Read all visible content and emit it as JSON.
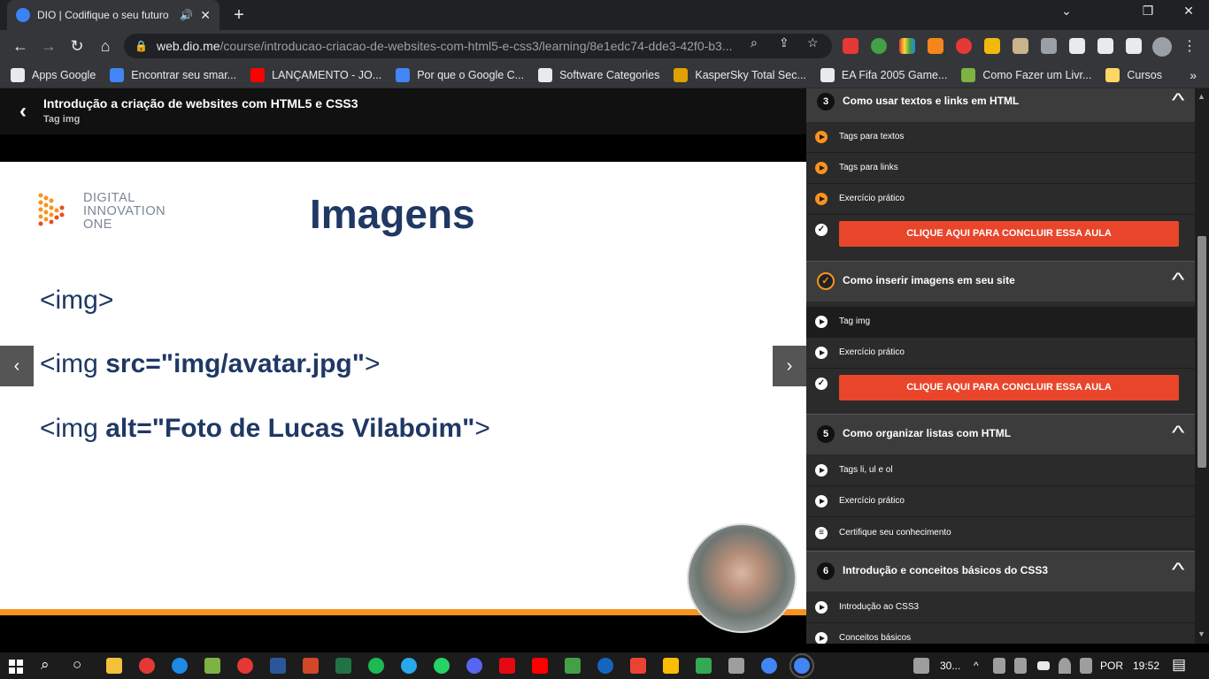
{
  "browser": {
    "tab_title": "DIO | Codifique o seu futuro",
    "tab_audio_icon": "🔊",
    "tab_close_icon": "✕",
    "new_tab_icon": "+",
    "url_host": "web.dio.me",
    "url_path": "/course/introducao-criacao-de-websites-com-html5-e-css3/learning/8e1edc74-dde3-42f0-b3...",
    "window_controls": [
      "⌄",
      "❐",
      "✕"
    ],
    "bookmarks": [
      {
        "label": "Apps Google",
        "color": "#e8eaed"
      },
      {
        "label": "Encontrar seu smar...",
        "color": "#4285f4"
      },
      {
        "label": "LANÇAMENTO - JO...",
        "color": "#ff0000"
      },
      {
        "label": "Por que o Google C...",
        "color": "#4285f4"
      },
      {
        "label": "Software Categories",
        "color": "#e8eaed"
      },
      {
        "label": "KasperSky Total Sec...",
        "color": "#e0a000"
      },
      {
        "label": "EA Fifa 2005 Game...",
        "color": "#e8eaed"
      },
      {
        "label": "Como Fazer um Livr...",
        "color": "#7cb342"
      },
      {
        "label": "Cursos",
        "color": "#fdd663"
      }
    ],
    "bookmarks_more": "»"
  },
  "course": {
    "title": "Introdução a criação de websites com HTML5 e CSS3",
    "current_lesson": "Tag img",
    "back_icon": "‹"
  },
  "slide": {
    "logo_text": [
      "DIGITAL",
      "INNOVATION",
      "ONE"
    ],
    "title": "Imagens",
    "line1": "<img>",
    "line2_prefix": "<img ",
    "line2_bold": "src=\"img/avatar.jpg\"",
    "line2_suffix": ">",
    "line3_prefix": "<img ",
    "line3_bold": "alt=\"Foto de Lucas Vilaboim\"",
    "line3_suffix": ">",
    "prev_icon": "‹",
    "next_icon": "›"
  },
  "sidebar": {
    "sections": [
      {
        "number": "3",
        "title": "Como usar textos e links em HTML",
        "items": [
          "Tags para textos",
          "Tags para links",
          "Exercício prático"
        ],
        "cta": "CLIQUE AQUI PARA CONCLUIR ESSA AULA"
      },
      {
        "number": "✓",
        "title": "Como inserir imagens em seu site",
        "items": [
          "Tag img",
          "Exercício prático"
        ],
        "cta": "CLIQUE AQUI PARA CONCLUIR ESSA AULA"
      },
      {
        "number": "5",
        "title": "Como organizar listas com HTML",
        "items": [
          "Tags li, ul e ol",
          "Exercício prático",
          "Certifique seu conhecimento"
        ]
      },
      {
        "number": "6",
        "title": "Introdução e conceitos básicos do CSS3",
        "items": [
          "Introdução ao CSS3",
          "Conceitos básicos"
        ]
      }
    ],
    "chevron_icon": "^",
    "check_icon": "✓",
    "quiz_icon": "≡"
  },
  "taskbar": {
    "search_icon": "⌕",
    "task_icon": "○",
    "tray_weather": "30...",
    "tray_chevron": "^",
    "language": "POR",
    "time": "19:52",
    "notification_icon": "▤"
  },
  "colors": {
    "accent_orange": "#f7931e",
    "cta_red": "#e8452b",
    "slide_navy": "#1f3864"
  }
}
